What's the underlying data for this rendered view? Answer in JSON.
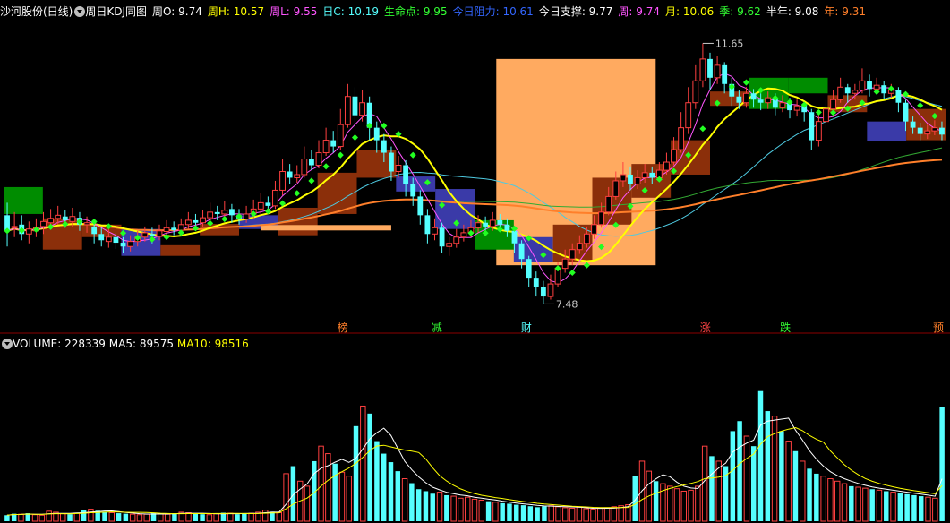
{
  "header": {
    "stock": "沙河股份(日线)",
    "indicator": "周日KDJ同图",
    "items": [
      {
        "label": "周O:",
        "value": "9.74",
        "color": "#ffffff"
      },
      {
        "label": "周H:",
        "value": "10.57",
        "color": "#ffff00"
      },
      {
        "label": "周L:",
        "value": "9.55",
        "color": "#ff55ff"
      },
      {
        "label": "日C:",
        "value": "10.19",
        "color": "#55ffff"
      },
      {
        "label": "生命点:",
        "value": "9.95",
        "color": "#33ff33"
      },
      {
        "label": "今日阻力:",
        "value": "10.61",
        "color": "#3366ff"
      },
      {
        "label": "今日支撑:",
        "value": "9.77",
        "color": "#ffffff"
      },
      {
        "label": "周:",
        "value": "9.74",
        "color": "#ff55ff"
      },
      {
        "label": "月:",
        "value": "10.06",
        "color": "#ffff00"
      },
      {
        "label": "季:",
        "value": "9.62",
        "color": "#33ff33"
      },
      {
        "label": "半年:",
        "value": "9.08",
        "color": "#ffffff"
      },
      {
        "label": "年:",
        "value": "9.31",
        "color": "#ff7f2a"
      }
    ]
  },
  "volume_header": {
    "label": "VOLUME:",
    "value": "228339",
    "ma5_label": "MA5:",
    "ma5": "89575",
    "ma10_label": "MA10:",
    "ma10": "98516"
  },
  "chart_data": [
    {
      "type": "candlestick",
      "title": "沙河股份(日线) 周日KDJ同图",
      "ylim": [
        7.3,
        12.0
      ],
      "annotations": {
        "high_label": "11.65",
        "low_label": "7.48"
      },
      "day_markers": [
        {
          "text": "榜",
          "color": "#ff7f2a"
        },
        {
          "text": "减",
          "color": "#33ff33"
        },
        {
          "text": "财",
          "color": "#55ffff"
        },
        {
          "text": "涨",
          "color": "#ff4444"
        },
        {
          "text": "跌",
          "color": "#33ff33"
        },
        {
          "text": "预",
          "color": "#ff7f2a"
        }
      ],
      "week_boxes": [
        {
          "o": 8.92,
          "c": 9.35,
          "color": "#008c00"
        },
        {
          "o": 8.85,
          "c": 8.35,
          "color": "#8b2f0a"
        },
        {
          "o": 8.55,
          "c": 8.75,
          "color": "#8b2f0a"
        },
        {
          "o": 8.68,
          "c": 8.25,
          "color": "#3a3aa8"
        },
        {
          "o": 8.25,
          "c": 8.42,
          "color": "#8b2f0a"
        },
        {
          "o": 8.58,
          "c": 8.76,
          "color": "#8b2f0a"
        },
        {
          "o": 8.68,
          "c": 8.9,
          "color": "#3a3aa8"
        },
        {
          "o": 8.58,
          "c": 9.02,
          "color": "#8b2f0a"
        },
        {
          "o": 8.92,
          "c": 9.58,
          "color": "#8b2f0a"
        },
        {
          "o": 9.5,
          "c": 9.95,
          "color": "#8b2f0a"
        },
        {
          "o": 9.28,
          "c": 9.52,
          "color": "#3a3aa8"
        },
        {
          "o": 9.32,
          "c": 8.68,
          "color": "#3a3aa8"
        },
        {
          "o": 8.35,
          "c": 8.82,
          "color": "#008c00"
        },
        {
          "o": 8.55,
          "c": 8.15,
          "color": "#3a3aa8"
        },
        {
          "o": 8.15,
          "c": 8.75,
          "color": "#8b2f0a"
        },
        {
          "o": 8.75,
          "c": 9.5,
          "color": "#8b2f0a"
        },
        {
          "o": 9.18,
          "c": 9.72,
          "color": "#8b2f0a"
        },
        {
          "o": 9.55,
          "c": 10.1,
          "color": "#8b2f0a"
        },
        {
          "o": 10.65,
          "c": 10.88,
          "color": "#8b2f0a"
        },
        {
          "o": 10.6,
          "c": 11.1,
          "color": "#008c00"
        },
        {
          "o": 10.85,
          "c": 11.1,
          "color": "#008c00"
        },
        {
          "o": 10.55,
          "c": 10.82,
          "color": "#8b2f0a"
        },
        {
          "o": 10.08,
          "c": 10.4,
          "color": "#3a3aa8"
        },
        {
          "o": 10.1,
          "c": 10.6,
          "color": "#8b2f0a"
        }
      ],
      "big_box": {
        "o": 8.1,
        "c": 11.4,
        "color": "#ffaa60"
      },
      "support_band": {
        "value": 8.7,
        "color": "#ffaa60"
      },
      "candles": [
        [
          8.9,
          8.65,
          9.1,
          8.4
        ],
        [
          8.7,
          8.72,
          8.95,
          8.55
        ],
        [
          8.75,
          8.6,
          8.9,
          8.5
        ],
        [
          8.6,
          8.68,
          8.8,
          8.45
        ],
        [
          8.65,
          8.7,
          8.85,
          8.55
        ],
        [
          8.72,
          8.8,
          8.95,
          8.6
        ],
        [
          8.78,
          8.85,
          9.0,
          8.7
        ],
        [
          8.85,
          8.9,
          9.05,
          8.75
        ],
        [
          8.88,
          8.82,
          8.98,
          8.7
        ],
        [
          8.8,
          8.88,
          9.02,
          8.72
        ],
        [
          8.86,
          8.75,
          8.95,
          8.65
        ],
        [
          8.75,
          8.78,
          8.88,
          8.62
        ],
        [
          8.72,
          8.6,
          8.82,
          8.45
        ],
        [
          8.6,
          8.5,
          8.7,
          8.4
        ],
        [
          8.48,
          8.55,
          8.68,
          8.38
        ],
        [
          8.55,
          8.46,
          8.62,
          8.36
        ],
        [
          8.46,
          8.4,
          8.55,
          8.3
        ],
        [
          8.4,
          8.48,
          8.58,
          8.32
        ],
        [
          8.48,
          8.55,
          8.65,
          8.4
        ],
        [
          8.55,
          8.62,
          8.72,
          8.48
        ],
        [
          8.6,
          8.56,
          8.7,
          8.45
        ],
        [
          8.56,
          8.65,
          8.75,
          8.5
        ],
        [
          8.64,
          8.7,
          8.82,
          8.58
        ],
        [
          8.7,
          8.66,
          8.8,
          8.58
        ],
        [
          8.66,
          8.75,
          8.85,
          8.6
        ],
        [
          8.75,
          8.82,
          8.95,
          8.68
        ],
        [
          8.82,
          8.78,
          8.92,
          8.7
        ],
        [
          8.78,
          8.86,
          8.98,
          8.72
        ],
        [
          8.86,
          8.95,
          9.1,
          8.8
        ],
        [
          8.95,
          8.92,
          9.05,
          8.82
        ],
        [
          8.92,
          8.98,
          9.12,
          8.85
        ],
        [
          9.0,
          8.9,
          9.08,
          8.78
        ],
        [
          8.9,
          8.85,
          9.0,
          8.75
        ],
        [
          8.84,
          8.92,
          9.05,
          8.78
        ],
        [
          8.92,
          9.0,
          9.15,
          8.85
        ],
        [
          9.0,
          9.1,
          9.25,
          8.92
        ],
        [
          9.1,
          9.05,
          9.2,
          8.95
        ],
        [
          9.05,
          9.3,
          9.45,
          9.0
        ],
        [
          9.3,
          9.6,
          9.8,
          9.22
        ],
        [
          9.6,
          9.5,
          9.72,
          9.4
        ],
        [
          9.5,
          9.55,
          9.7,
          9.42
        ],
        [
          9.55,
          9.8,
          10.0,
          9.5
        ],
        [
          9.8,
          9.7,
          9.95,
          9.62
        ],
        [
          9.7,
          9.9,
          10.1,
          9.65
        ],
        [
          9.9,
          10.1,
          10.3,
          9.85
        ],
        [
          10.1,
          10.0,
          10.25,
          9.9
        ],
        [
          10.0,
          10.35,
          10.6,
          9.95
        ],
        [
          10.35,
          10.8,
          11.0,
          10.3
        ],
        [
          10.8,
          10.5,
          10.95,
          10.3
        ],
        [
          10.5,
          10.7,
          10.9,
          10.4
        ],
        [
          10.7,
          10.3,
          10.8,
          10.1
        ],
        [
          10.3,
          10.1,
          10.4,
          9.9
        ],
        [
          10.1,
          9.9,
          10.2,
          9.75
        ],
        [
          9.9,
          9.6,
          10.0,
          9.45
        ],
        [
          9.6,
          9.7,
          9.85,
          9.5
        ],
        [
          9.7,
          9.4,
          9.78,
          9.2
        ],
        [
          9.4,
          9.2,
          9.5,
          9.05
        ],
        [
          9.2,
          8.9,
          9.3,
          8.75
        ],
        [
          8.9,
          8.6,
          9.0,
          8.45
        ],
        [
          8.6,
          8.7,
          8.85,
          8.5
        ],
        [
          8.7,
          8.4,
          8.78,
          8.3
        ],
        [
          8.4,
          8.45,
          8.55,
          8.25
        ],
        [
          8.45,
          8.55,
          8.68,
          8.38
        ],
        [
          8.55,
          8.62,
          8.75,
          8.48
        ],
        [
          8.62,
          8.7,
          8.82,
          8.55
        ],
        [
          8.7,
          8.78,
          8.9,
          8.62
        ],
        [
          8.78,
          8.72,
          8.88,
          8.6
        ],
        [
          8.72,
          8.82,
          8.95,
          8.65
        ],
        [
          8.82,
          8.75,
          8.92,
          8.65
        ],
        [
          8.75,
          8.65,
          8.85,
          8.55
        ],
        [
          8.65,
          8.45,
          8.72,
          8.3
        ],
        [
          8.45,
          8.2,
          8.5,
          8.05
        ],
        [
          8.2,
          7.9,
          8.25,
          7.75
        ],
        [
          7.9,
          7.75,
          8.0,
          7.6
        ],
        [
          7.75,
          7.6,
          7.85,
          7.48
        ],
        [
          7.6,
          7.8,
          7.95,
          7.55
        ],
        [
          7.8,
          8.05,
          8.15,
          7.75
        ],
        [
          8.05,
          8.2,
          8.35,
          7.98
        ],
        [
          8.2,
          8.35,
          8.45,
          8.1
        ],
        [
          8.35,
          8.45,
          8.58,
          8.28
        ],
        [
          8.45,
          8.6,
          8.72,
          8.38
        ],
        [
          8.6,
          8.75,
          8.9,
          8.52
        ],
        [
          8.75,
          8.95,
          9.1,
          8.7
        ],
        [
          8.95,
          9.2,
          9.35,
          8.9
        ],
        [
          9.2,
          9.45,
          9.6,
          9.15
        ],
        [
          9.45,
          9.55,
          9.75,
          9.35
        ],
        [
          9.55,
          9.4,
          9.68,
          9.3
        ],
        [
          9.4,
          9.5,
          9.62,
          9.32
        ],
        [
          9.5,
          9.58,
          9.72,
          9.42
        ],
        [
          9.58,
          9.5,
          9.68,
          9.4
        ],
        [
          9.5,
          9.62,
          9.75,
          9.45
        ],
        [
          9.62,
          9.75,
          9.9,
          9.55
        ],
        [
          9.75,
          9.95,
          10.15,
          9.7
        ],
        [
          9.95,
          10.3,
          10.55,
          9.9
        ],
        [
          10.3,
          10.7,
          10.95,
          10.2
        ],
        [
          10.7,
          11.05,
          11.3,
          10.6
        ],
        [
          11.05,
          11.4,
          11.65,
          10.95
        ],
        [
          11.4,
          11.1,
          11.5,
          10.9
        ],
        [
          11.1,
          11.3,
          11.45,
          11.0
        ],
        [
          11.3,
          11.0,
          11.35,
          10.85
        ],
        [
          11.0,
          10.8,
          11.1,
          10.65
        ],
        [
          10.8,
          10.7,
          10.9,
          10.6
        ],
        [
          10.7,
          10.85,
          10.95,
          10.62
        ],
        [
          10.85,
          10.75,
          10.92,
          10.62
        ],
        [
          10.75,
          10.7,
          10.85,
          10.58
        ],
        [
          10.7,
          10.78,
          10.88,
          10.6
        ],
        [
          10.78,
          10.62,
          10.85,
          10.5
        ],
        [
          10.62,
          10.7,
          10.82,
          10.55
        ],
        [
          10.7,
          10.58,
          10.78,
          10.45
        ],
        [
          10.58,
          10.65,
          10.75,
          10.48
        ],
        [
          10.65,
          10.55,
          10.7,
          10.4
        ],
        [
          10.55,
          10.1,
          10.6,
          9.95
        ],
        [
          10.1,
          10.4,
          10.55,
          10.0
        ],
        [
          10.4,
          10.6,
          10.75,
          10.3
        ],
        [
          10.6,
          10.75,
          10.9,
          10.55
        ],
        [
          10.75,
          10.95,
          11.1,
          10.7
        ],
        [
          10.95,
          10.85,
          11.0,
          10.7
        ],
        [
          10.85,
          10.9,
          11.0,
          10.75
        ],
        [
          10.9,
          11.05,
          11.25,
          10.85
        ],
        [
          11.05,
          10.92,
          11.15,
          10.8
        ],
        [
          10.92,
          10.98,
          11.1,
          10.85
        ],
        [
          10.98,
          10.85,
          11.05,
          10.75
        ],
        [
          10.85,
          10.9,
          11.0,
          10.78
        ],
        [
          10.9,
          10.7,
          10.95,
          10.55
        ],
        [
          10.7,
          10.4,
          10.75,
          10.25
        ],
        [
          10.4,
          10.3,
          10.48,
          10.2
        ],
        [
          10.3,
          10.2,
          10.38,
          10.1
        ],
        [
          10.2,
          10.25,
          10.35,
          10.12
        ],
        [
          10.25,
          10.3,
          10.42,
          10.18
        ],
        [
          10.3,
          10.19,
          10.4,
          10.1
        ]
      ],
      "ma_lines": [
        {
          "name": "周",
          "color": "#ffff00"
        },
        {
          "name": "季",
          "color": "#33ff33"
        },
        {
          "name": "年",
          "color": "#ff7f2a"
        }
      ]
    },
    {
      "type": "bar",
      "title": "VOLUME",
      "ylim": [
        0,
        340000
      ],
      "volumes": [
        12000,
        15000,
        14000,
        16000,
        13000,
        12000,
        20000,
        18000,
        15000,
        14000,
        16000,
        22000,
        24000,
        21000,
        19000,
        17000,
        16000,
        15000,
        14000,
        13000,
        14000,
        16000,
        15000,
        14000,
        16000,
        18000,
        17000,
        15000,
        14000,
        13000,
        15000,
        17000,
        16000,
        14000,
        15000,
        16000,
        18000,
        22000,
        19000,
        17000,
        95000,
        110000,
        80000,
        70000,
        120000,
        150000,
        135000,
        115000,
        98000,
        90000,
        190000,
        230000,
        215000,
        160000,
        135000,
        118000,
        100000,
        85000,
        76000,
        64000,
        60000,
        55000,
        58000,
        52000,
        50000,
        46000,
        48000,
        44000,
        42000,
        40000,
        38000,
        36000,
        35000,
        33000,
        32000,
        30000,
        28000,
        30000,
        31000,
        29000,
        27000,
        26000,
        28000,
        25000,
        24000,
        26000,
        27000,
        29000,
        31000,
        33000,
        90000,
        120000,
        100000,
        80000,
        75000,
        70000,
        65000,
        60000,
        62000,
        70000,
        150000,
        130000,
        120000,
        110000,
        180000,
        200000,
        170000,
        150000,
        260000,
        220000,
        210000,
        180000,
        160000,
        140000,
        120000,
        105000,
        95000,
        90000,
        85000,
        80000,
        75000,
        70000,
        68000,
        66000,
        64000,
        62000,
        60000,
        58000,
        56000,
        54000,
        52000,
        50000,
        48000,
        46000,
        228339
      ],
      "ma5_color": "#ffffff",
      "ma10_color": "#ffff00"
    }
  ]
}
